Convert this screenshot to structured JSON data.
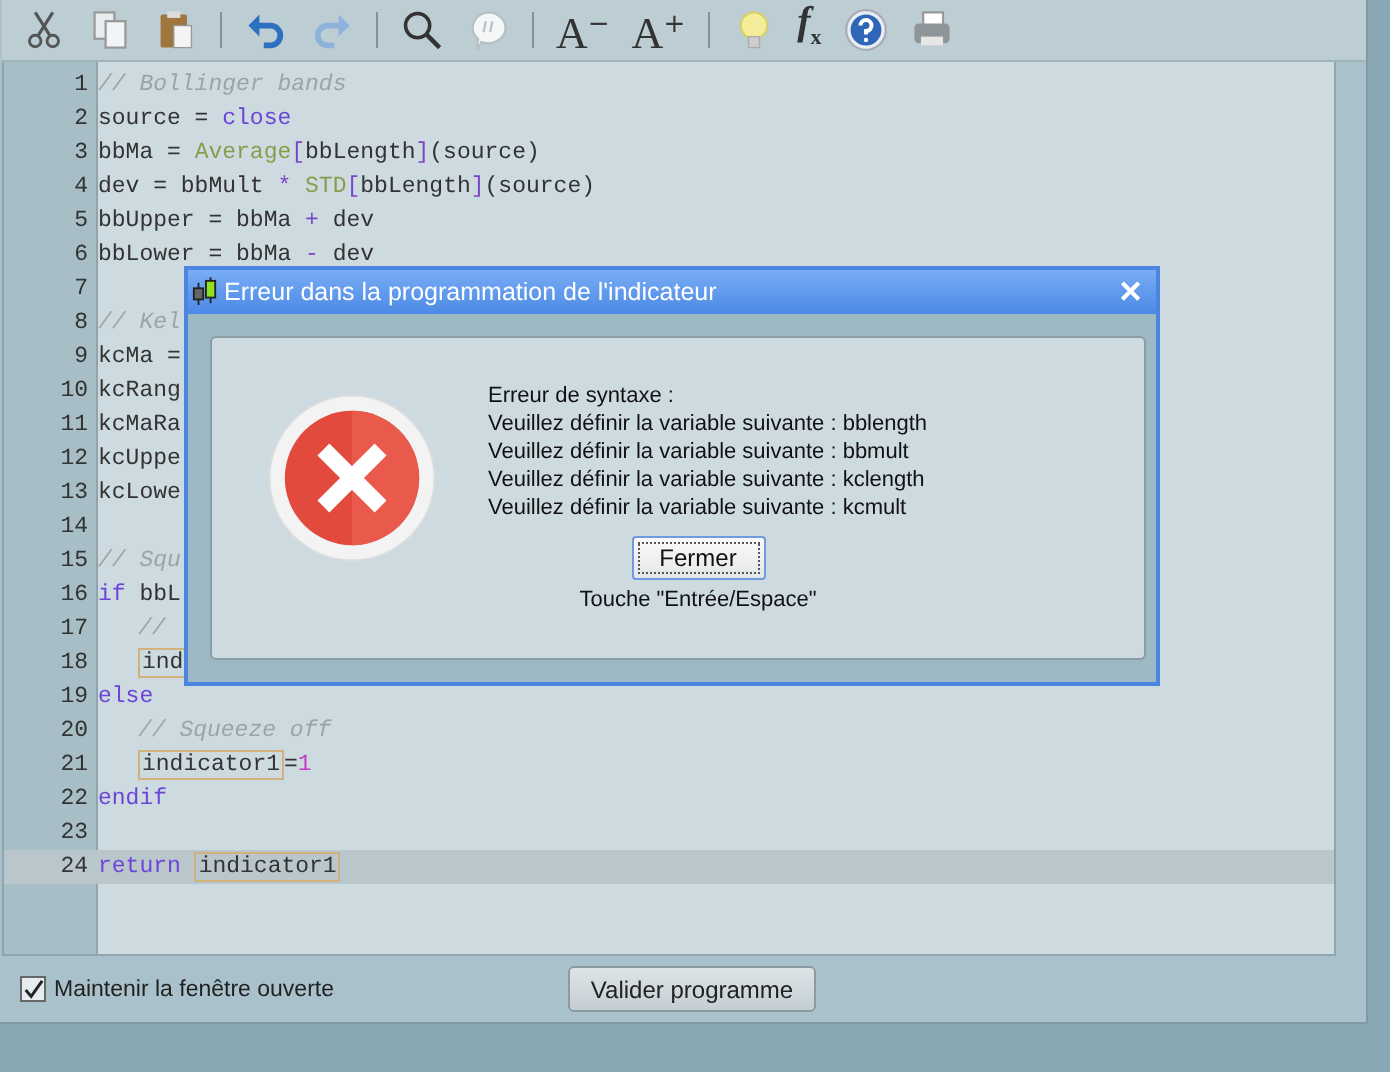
{
  "toolbar": [
    {
      "kind": "cut"
    },
    {
      "kind": "copy"
    },
    {
      "kind": "paste"
    },
    {
      "kind": "sep"
    },
    {
      "kind": "undo"
    },
    {
      "kind": "redo"
    },
    {
      "kind": "sep"
    },
    {
      "kind": "search"
    },
    {
      "kind": "comment"
    },
    {
      "kind": "sep"
    },
    {
      "kind": "font",
      "glyph": "A",
      "sign": "−"
    },
    {
      "kind": "font",
      "glyph": "A",
      "sign": "+"
    },
    {
      "kind": "sep"
    },
    {
      "kind": "bulb"
    },
    {
      "kind": "fx",
      "glyph": "f",
      "sub": "x"
    },
    {
      "kind": "help"
    },
    {
      "kind": "print"
    }
  ],
  "editor": {
    "lines": [
      {
        "number": "1",
        "tokens": [
          {
            "kind": "comment",
            "text": "// Bollinger bands"
          }
        ]
      },
      {
        "number": "2",
        "tokens": [
          {
            "kind": "plain",
            "text": "source = "
          },
          {
            "kind": "keyword",
            "text": "close"
          }
        ]
      },
      {
        "number": "3",
        "tokens": [
          {
            "kind": "plain",
            "text": "bbMa = "
          },
          {
            "kind": "func",
            "text": "Average"
          },
          {
            "kind": "op",
            "text": "["
          },
          {
            "kind": "plain",
            "text": "bbLength"
          },
          {
            "kind": "op",
            "text": "]"
          },
          {
            "kind": "plain",
            "text": "(source)"
          }
        ]
      },
      {
        "number": "4",
        "tokens": [
          {
            "kind": "plain",
            "text": "dev = bbMult "
          },
          {
            "kind": "op",
            "text": "* "
          },
          {
            "kind": "func",
            "text": "STD"
          },
          {
            "kind": "op",
            "text": "["
          },
          {
            "kind": "plain",
            "text": "bbLength"
          },
          {
            "kind": "op",
            "text": "]"
          },
          {
            "kind": "plain",
            "text": "(source)"
          }
        ]
      },
      {
        "number": "5",
        "tokens": [
          {
            "kind": "plain",
            "text": "bbUpper = bbMa "
          },
          {
            "kind": "op",
            "text": "+"
          },
          {
            "kind": "plain",
            "text": " dev"
          }
        ]
      },
      {
        "number": "6",
        "tokens": [
          {
            "kind": "plain",
            "text": "bbLower = bbMa "
          },
          {
            "kind": "op",
            "text": "-"
          },
          {
            "kind": "plain",
            "text": " dev"
          }
        ]
      },
      {
        "number": "7"
      },
      {
        "number": "8",
        "tokens": [
          {
            "kind": "comment",
            "text": "// Kel"
          }
        ]
      },
      {
        "number": "9",
        "tokens": [
          {
            "kind": "plain",
            "text": "kcMa ="
          }
        ]
      },
      {
        "number": "10",
        "tokens": [
          {
            "kind": "plain",
            "text": "kcRang"
          }
        ]
      },
      {
        "number": "11",
        "tokens": [
          {
            "kind": "plain",
            "text": "kcMaRa"
          }
        ]
      },
      {
        "number": "12",
        "tokens": [
          {
            "kind": "plain",
            "text": "kcUppe"
          }
        ]
      },
      {
        "number": "13",
        "tokens": [
          {
            "kind": "plain",
            "text": "kcLowe"
          }
        ]
      },
      {
        "number": "14"
      },
      {
        "number": "15",
        "tokens": [
          {
            "kind": "comment",
            "text": "// Squ"
          }
        ]
      },
      {
        "number": "16",
        "tokens": [
          {
            "kind": "keyword",
            "text": "if"
          },
          {
            "kind": "plain",
            "text": " bbL"
          }
        ]
      },
      {
        "number": "17",
        "indent": true,
        "tokens": [
          {
            "kind": "comment",
            "text": "//"
          }
        ]
      },
      {
        "number": "18",
        "indent": true,
        "tokens": [
          {
            "kind": "boxed",
            "text": "ind"
          }
        ]
      },
      {
        "number": "19",
        "tokens": [
          {
            "kind": "keyword",
            "text": "else"
          }
        ]
      },
      {
        "number": "20",
        "indent": true,
        "tokens": [
          {
            "kind": "comment",
            "text": "// Squeeze off"
          }
        ]
      },
      {
        "number": "21",
        "indent": true,
        "tokens": [
          {
            "kind": "boxed",
            "text": "indicator1"
          },
          {
            "kind": "plain",
            "text": "="
          },
          {
            "kind": "number",
            "text": "1"
          }
        ]
      },
      {
        "number": "22",
        "tokens": [
          {
            "kind": "keyword",
            "text": "endif"
          }
        ]
      },
      {
        "number": "23"
      },
      {
        "number": "24",
        "current": true,
        "tokens": [
          {
            "kind": "keyword",
            "text": "return "
          },
          {
            "kind": "boxed",
            "text": "indicator1"
          }
        ]
      }
    ]
  },
  "keep_open": {
    "label": "Maintenir la fenêtre ouverte",
    "checked": true
  },
  "validate_button": "Valider programme",
  "dialog": {
    "title": "Erreur dans la programmation de l'indicateur",
    "close": "✕",
    "heading": "Erreur de syntaxe :",
    "messages": [
      "Veuillez définir la variable suivante : bblength",
      "Veuillez définir la variable suivante : bbmult",
      "Veuillez définir la variable suivante : kclength",
      "Veuillez définir la variable suivante : kcmult"
    ],
    "button": "Fermer",
    "hint": "Touche \"Entrée/Espace\""
  }
}
